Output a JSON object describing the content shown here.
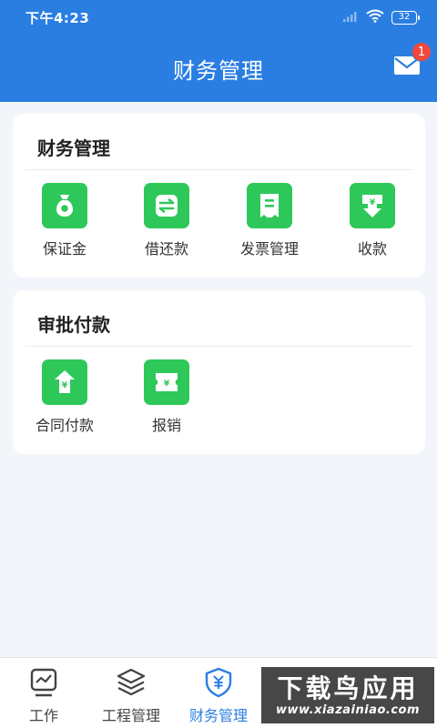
{
  "status_bar": {
    "time": "下午4:23",
    "battery": "32"
  },
  "header": {
    "title": "财务管理",
    "mail_badge": "1"
  },
  "colors": {
    "primary": "#2a7ee2",
    "tile_green": "#2ec85a",
    "badge_red": "#f0483e"
  },
  "sections": [
    {
      "title": "财务管理",
      "items": [
        {
          "label": "保证金",
          "icon": "money-bag-icon"
        },
        {
          "label": "借还款",
          "icon": "exchange-icon"
        },
        {
          "label": "发票管理",
          "icon": "invoice-icon"
        },
        {
          "label": "收款",
          "icon": "receive-money-icon"
        }
      ]
    },
    {
      "title": "审批付款",
      "items": [
        {
          "label": "合同付款",
          "icon": "contract-payment-icon"
        },
        {
          "label": "报销",
          "icon": "reimbursement-icon"
        }
      ]
    }
  ],
  "tabbar": {
    "tabs": [
      {
        "label": "工作",
        "icon": "chart-monitor-icon"
      },
      {
        "label": "工程管理",
        "icon": "layers-icon"
      },
      {
        "label": "财务管理",
        "icon": "yuan-shield-icon",
        "active": true
      }
    ]
  },
  "watermark": {
    "title": "下载鸟应用",
    "url": "www.xiazainiao.com"
  }
}
